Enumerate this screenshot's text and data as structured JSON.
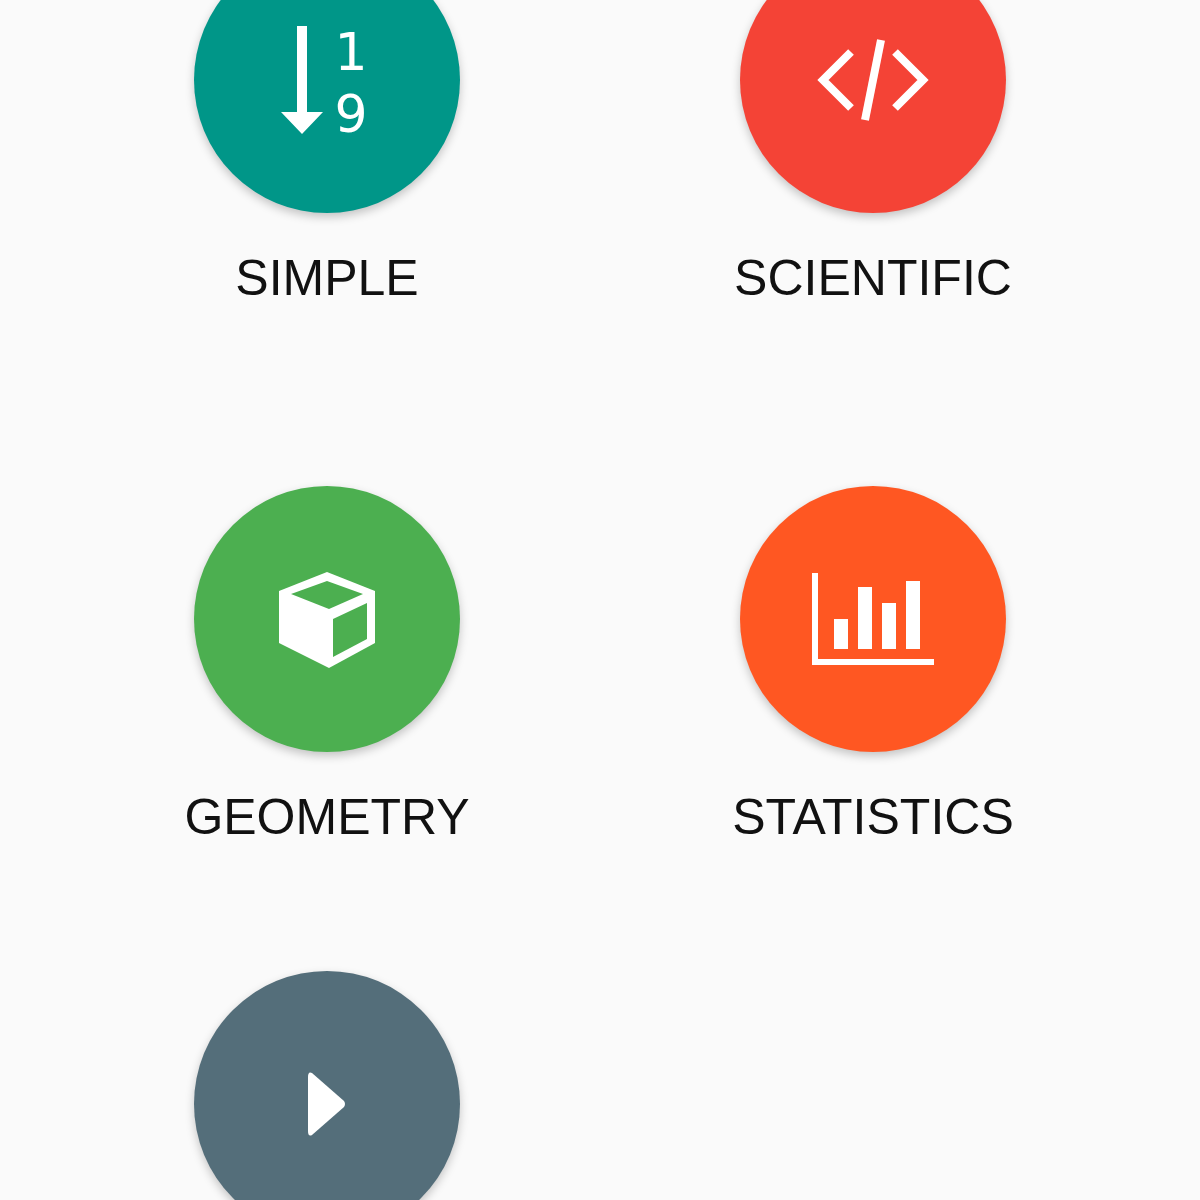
{
  "modes": [
    {
      "kind": "sort",
      "color": "#009688",
      "icon_digits": [
        "1",
        "9"
      ],
      "label": "SIMPLE"
    },
    {
      "kind": "code",
      "color": "#f44336",
      "label": "SCIENTIFIC"
    },
    {
      "kind": "cube",
      "color": "#4caf50",
      "label": "GEOMETRY"
    },
    {
      "kind": "chart",
      "color": "#ff5722",
      "label": "STATISTICS"
    },
    {
      "kind": "play",
      "color": "#546e7a"
    }
  ]
}
